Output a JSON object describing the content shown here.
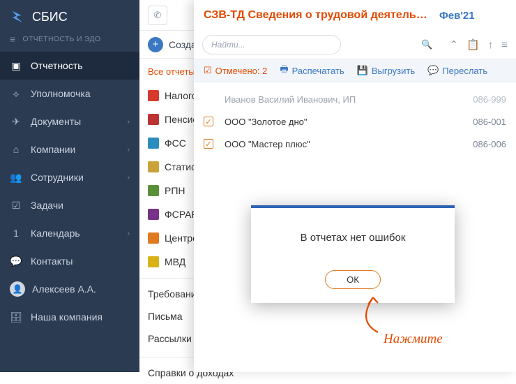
{
  "app": {
    "name": "СБИС",
    "subtitle": "ОТЧЕТНОСТЬ И ЭДО"
  },
  "nav": {
    "items": [
      {
        "label": "Отчетность",
        "expandable": false
      },
      {
        "label": "Уполномочка",
        "expandable": false
      },
      {
        "label": "Документы",
        "expandable": true
      },
      {
        "label": "Компании",
        "expandable": true
      },
      {
        "label": "Сотрудники",
        "expandable": true
      },
      {
        "label": "Задачи",
        "expandable": false
      },
      {
        "label": "Календарь",
        "expandable": true,
        "badge": "1"
      },
      {
        "label": "Контакты",
        "expandable": false
      }
    ],
    "user": "Алексеев А.А.",
    "company": "Наша компания"
  },
  "toolbar": {
    "create": "Создать"
  },
  "tabs": {
    "active": "Все отчеты"
  },
  "categories": [
    "Налоговая",
    "Пенсионный",
    "ФСС",
    "Статистика",
    "РПН",
    "ФСРАР",
    "Центробанк",
    "МВД"
  ],
  "plain": [
    "Требования",
    "Письма",
    "Рассылки"
  ],
  "plain2": [
    "Справки о доходах"
  ],
  "panel": {
    "title": "СЗВ-ТД Сведения о трудовой деятельно...",
    "period": "Фев'21",
    "search_placeholder": "Найти...",
    "selected_label": "Отмечено: 2",
    "actions": {
      "print": "Распечатать",
      "export": "Выгрузить",
      "forward": "Переслать"
    },
    "rows": [
      {
        "name": "Иванов Василий Иванович, ИП",
        "code": "086-999",
        "checked": false,
        "muted": true
      },
      {
        "name": "ООО \"Золотое дно\"",
        "code": "086-001",
        "checked": true,
        "muted": false
      },
      {
        "name": "ООО \"Мастер плюс\"",
        "code": "086-006",
        "checked": true,
        "muted": false
      }
    ]
  },
  "modal": {
    "message": "В отчетах нет ошибок",
    "ok": "ОК"
  },
  "annotation": {
    "text": "Нажмите"
  }
}
